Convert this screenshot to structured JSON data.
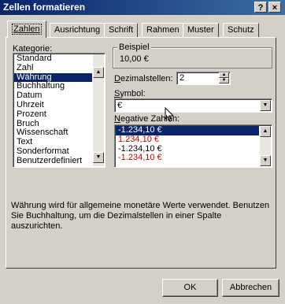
{
  "window": {
    "title": "Zellen formatieren",
    "help_button": "?",
    "close_button": "×"
  },
  "tabs": [
    "Zahlen",
    "Ausrichtung",
    "Schrift",
    "Rahmen",
    "Muster",
    "Schutz"
  ],
  "kategorie": {
    "label": "Kategorie:",
    "items": [
      "Standard",
      "Zahl",
      "Währung",
      "Buchhaltung",
      "Datum",
      "Uhrzeit",
      "Prozent",
      "Bruch",
      "Wissenschaft",
      "Text",
      "Sonderformat",
      "Benutzerdefiniert"
    ],
    "selected": "Währung"
  },
  "beispiel": {
    "label": "Beispiel",
    "value": "10,00 €"
  },
  "dezimalstellen": {
    "label": "Dezimalstellen:",
    "value": "2"
  },
  "symbol": {
    "label": "Symbol:",
    "value": "€"
  },
  "negative_zahlen": {
    "label": "Negative Zahlen:",
    "items": [
      {
        "text": "-1.234,10 €",
        "color": "black",
        "selected": true
      },
      {
        "text": "1.234,10 €",
        "color": "red",
        "selected": false
      },
      {
        "text": "-1.234,10 €",
        "color": "black",
        "selected": false
      },
      {
        "text": "-1.234,10 €",
        "color": "red",
        "selected": false
      }
    ]
  },
  "description": "Währung wird für allgemeine monetäre Werte verwendet. Benutzen Sie Buchhaltung, um die Dezimalstellen in einer Spalte auszurichten.",
  "buttons": {
    "ok": "OK",
    "cancel": "Abbrechen"
  },
  "colors": {
    "title_bar": "#0a246a",
    "selection": "#0a246a",
    "dialog_bg": "#d4d0c8",
    "negative_red": "#c00000"
  }
}
